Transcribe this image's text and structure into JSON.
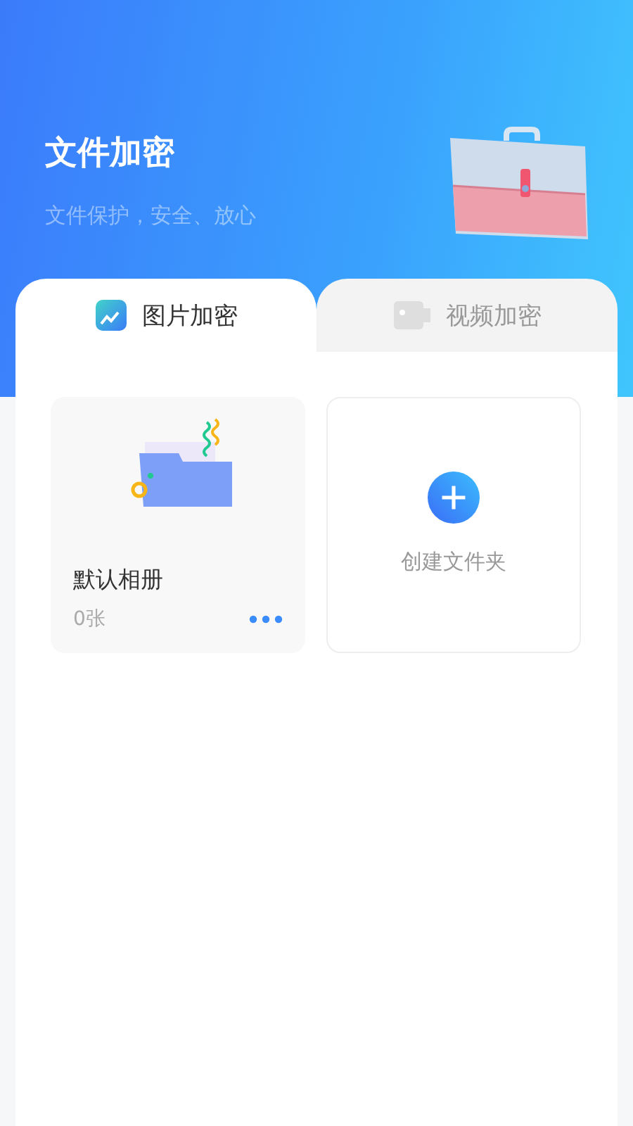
{
  "header": {
    "title": "文件加密",
    "subtitle": "文件保护，安全、放心"
  },
  "tabs": [
    {
      "label": "图片加密",
      "kind": "image",
      "selected": true
    },
    {
      "label": "视频加密",
      "kind": "video",
      "selected": false
    }
  ],
  "folders": [
    {
      "kind": "album",
      "name": "默认相册",
      "count": "0张"
    },
    {
      "kind": "create",
      "label": "创建文件夹"
    }
  ]
}
